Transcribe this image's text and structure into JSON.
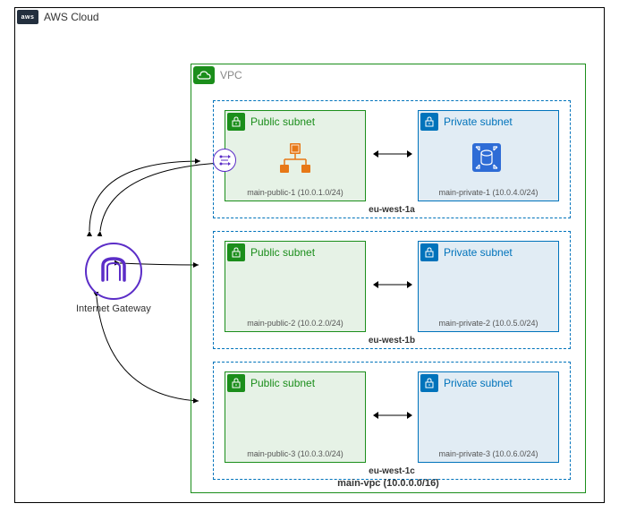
{
  "cloud": {
    "label": "AWS Cloud"
  },
  "vpc": {
    "label": "VPC",
    "name": "main-vpc (10.0.0.0/16)"
  },
  "igw": {
    "label": "Internet Gateway"
  },
  "azs": [
    {
      "name": "eu-west-1a",
      "public": {
        "label": "Public subnet",
        "cidr": "main-public-1 (10.0.1.0/24)"
      },
      "private": {
        "label": "Private subnet",
        "cidr": "main-private-1 (10.0.4.0/24)"
      }
    },
    {
      "name": "eu-west-1b",
      "public": {
        "label": "Public subnet",
        "cidr": "main-public-2 (10.0.2.0/24)"
      },
      "private": {
        "label": "Private subnet",
        "cidr": "main-private-2 (10.0.5.0/24)"
      }
    },
    {
      "name": "eu-west-1c",
      "public": {
        "label": "Public subnet",
        "cidr": "main-public-3 (10.0.3.0/24)"
      },
      "private": {
        "label": "Private subnet",
        "cidr": "main-private-3 (10.0.6.0/24)"
      }
    }
  ]
}
